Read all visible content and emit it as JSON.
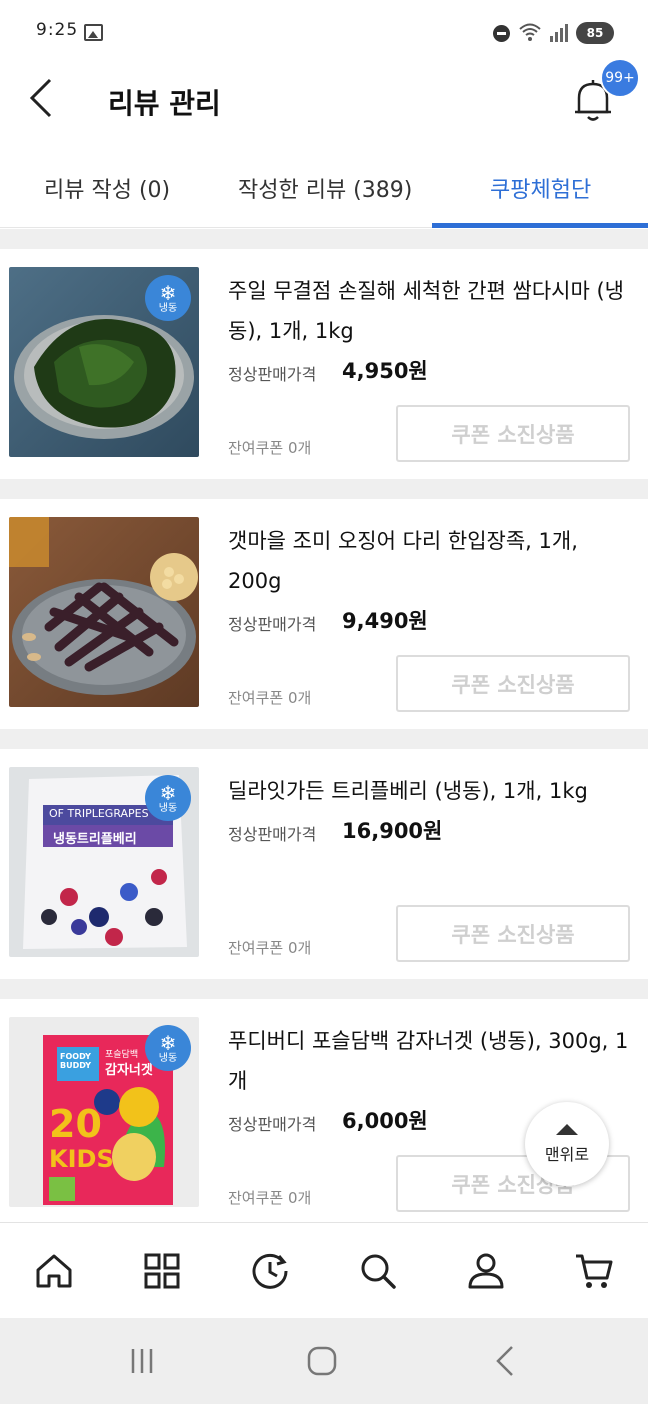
{
  "status_bar": {
    "time": "9:25",
    "battery": "85"
  },
  "header": {
    "title": "리뷰 관리",
    "notification_badge": "99+"
  },
  "tabs": [
    {
      "label": "리뷰 작성 (0)"
    },
    {
      "label": "작성한 리뷰 (389)"
    },
    {
      "label": "쿠팡체험단",
      "active": true
    }
  ],
  "products": [
    {
      "name": "주일 무결점 손질해 세척한 간편 쌈다시마 (냉동), 1개, 1kg",
      "price_label": "정상판매가격",
      "price": "4,950원",
      "coupon": "잔여쿠폰 0개",
      "button": "쿠폰 소진상품",
      "frozen_badge": "냉동"
    },
    {
      "name": "갯마을 조미 오징어 다리 한입장족, 1개, 200g",
      "price_label": "정상판매가격",
      "price": "9,490원",
      "coupon": "잔여쿠폰 0개",
      "button": "쿠폰 소진상품"
    },
    {
      "name": "딜라잇가든 트리플베리 (냉동), 1개, 1kg",
      "price_label": "정상판매가격",
      "price": "16,900원",
      "coupon": "잔여쿠폰 0개",
      "button": "쿠폰 소진상품",
      "frozen_badge": "냉동",
      "package_text": [
        "OF TRIPLEGRAPES",
        "냉동트리플베리"
      ]
    },
    {
      "name": "푸디버디 포슬담백 감자너겟 (냉동), 300g, 1개",
      "price_label": "정상판매가격",
      "price": "6,000원",
      "coupon": "잔여쿠폰 0개",
      "button": "쿠폰 소진상품",
      "frozen_badge": "냉동",
      "package_text": [
        "FOODY BUDDY",
        "포슬담백",
        "감자너겟",
        "KIDS"
      ]
    }
  ],
  "top_button": {
    "label": "맨위로"
  },
  "bottom_nav": [
    {
      "icon": "home-icon"
    },
    {
      "icon": "category-grid-icon"
    },
    {
      "icon": "history-clock-icon"
    },
    {
      "icon": "search-icon"
    },
    {
      "icon": "user-icon"
    },
    {
      "icon": "cart-icon"
    }
  ],
  "colors": {
    "accent": "#2e6fd6",
    "badge": "#3a7be0",
    "frozen": "#3a86d8",
    "disabled_text": "#cfcfcf"
  }
}
